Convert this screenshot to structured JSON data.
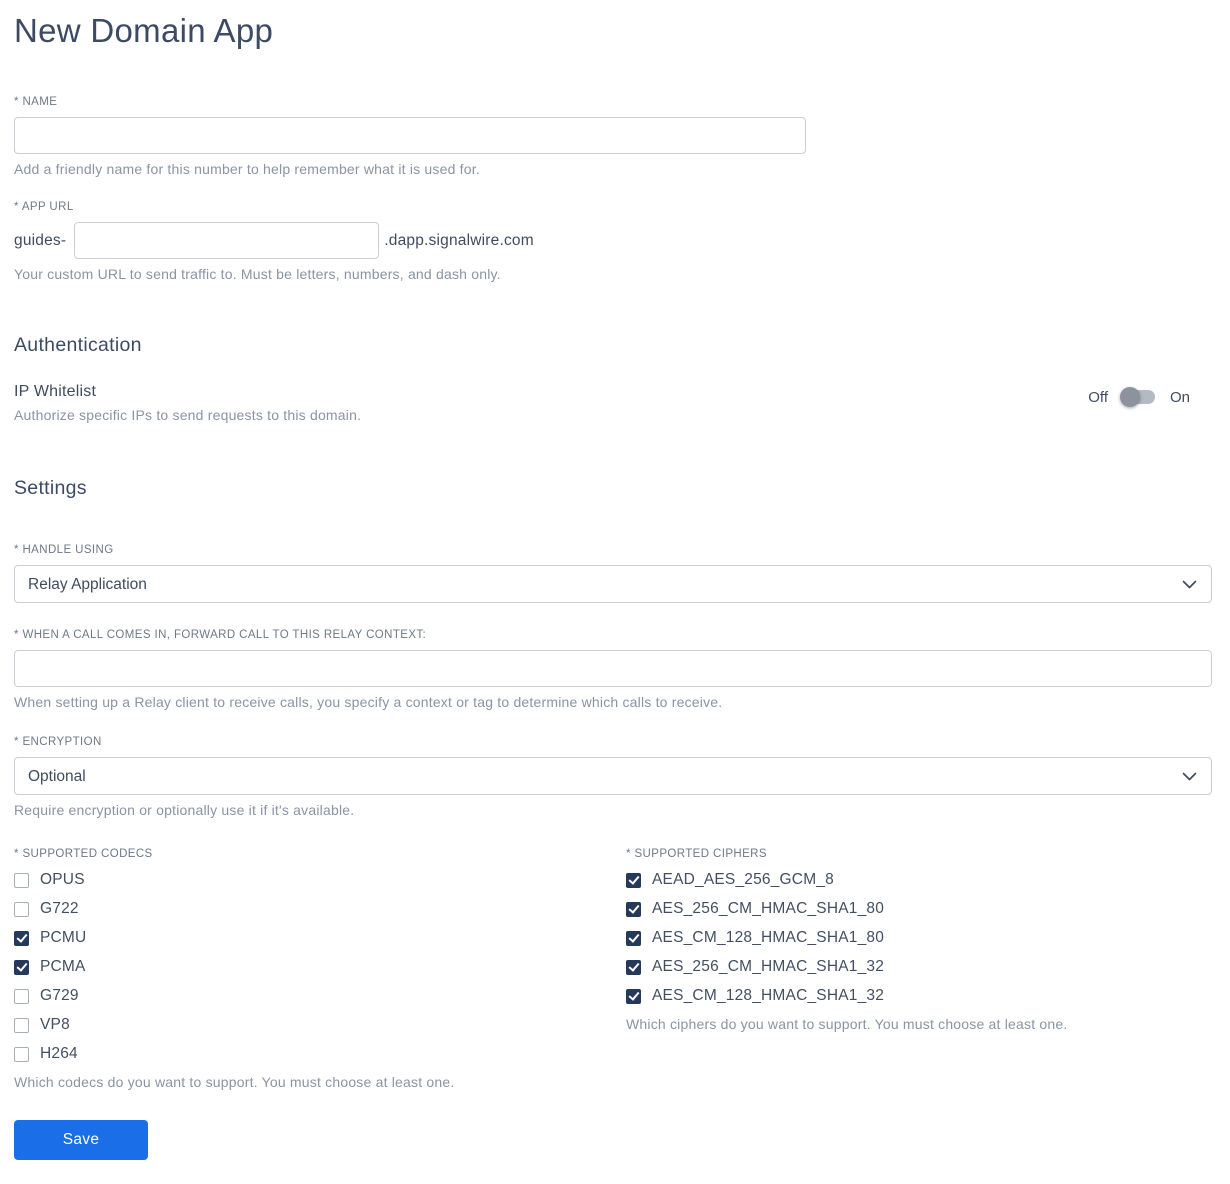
{
  "page": {
    "title": "New Domain App"
  },
  "name_field": {
    "label": "* NAME",
    "value": "",
    "helper": "Add a friendly name for this number to help remember what it is used for."
  },
  "app_url_field": {
    "label": "* APP URL",
    "prefix": "guides-",
    "value": "",
    "suffix": ".dapp.signalwire.com",
    "helper": "Your custom URL to send traffic to. Must be letters, numbers, and dash only."
  },
  "authentication": {
    "heading": "Authentication",
    "ip_whitelist": {
      "label": "IP Whitelist",
      "helper": "Authorize specific IPs to send requests to this domain.",
      "off_label": "Off",
      "on_label": "On",
      "is_on": false
    }
  },
  "settings": {
    "heading": "Settings",
    "handle_using": {
      "label": "* HANDLE USING",
      "value": "Relay Application"
    },
    "relay_context": {
      "label": "* WHEN A CALL COMES IN, FORWARD CALL TO THIS RELAY CONTEXT:",
      "value": "",
      "helper": "When setting up a Relay client to receive calls, you specify a context or tag to determine which calls to receive."
    },
    "encryption": {
      "label": "* ENCRYPTION",
      "value": "Optional",
      "helper": "Require encryption or optionally use it if it's available."
    },
    "codecs": {
      "label": "* SUPPORTED CODECS",
      "helper": "Which codecs do you want to support. You must choose at least one.",
      "items": [
        {
          "label": "OPUS",
          "checked": false
        },
        {
          "label": "G722",
          "checked": false
        },
        {
          "label": "PCMU",
          "checked": true
        },
        {
          "label": "PCMA",
          "checked": true
        },
        {
          "label": "G729",
          "checked": false
        },
        {
          "label": "VP8",
          "checked": false
        },
        {
          "label": "H264",
          "checked": false
        }
      ]
    },
    "ciphers": {
      "label": "* SUPPORTED CIPHERS",
      "helper": "Which ciphers do you want to support. You must choose at least one.",
      "items": [
        {
          "label": "AEAD_AES_256_GCM_8",
          "checked": true
        },
        {
          "label": "AES_256_CM_HMAC_SHA1_80",
          "checked": true
        },
        {
          "label": "AES_CM_128_HMAC_SHA1_80",
          "checked": true
        },
        {
          "label": "AES_256_CM_HMAC_SHA1_32",
          "checked": true
        },
        {
          "label": "AES_CM_128_HMAC_SHA1_32",
          "checked": true
        }
      ]
    }
  },
  "save_button": {
    "label": "Save"
  },
  "colors": {
    "accent_blue": "#1a6fe8",
    "checkbox_checked": "#25395c",
    "heading": "#3c4b63"
  }
}
